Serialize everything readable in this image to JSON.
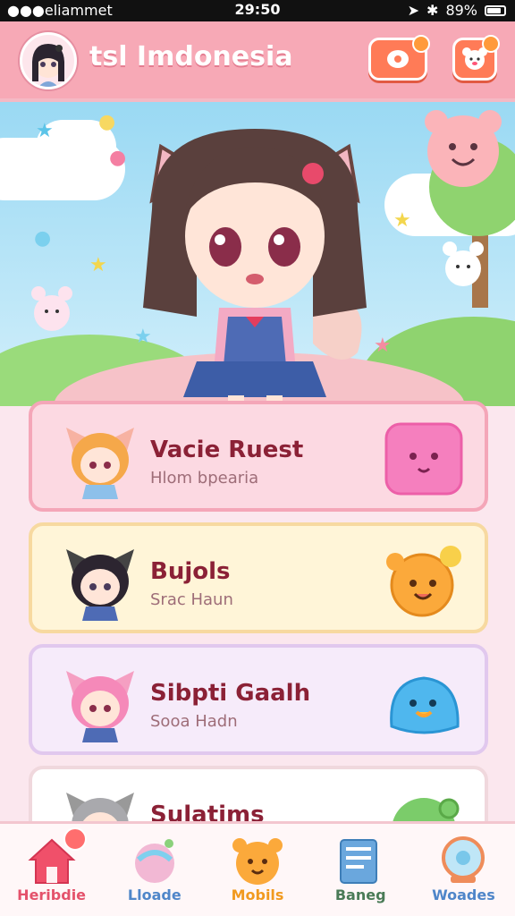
{
  "status_bar": {
    "carrier": "●●●eliammet",
    "time": "29:50",
    "battery": "89%"
  },
  "header": {
    "title": "tsl Imdonesia"
  },
  "cards": [
    {
      "name": "Vacie Ruest",
      "sub": "Hlom bpearia"
    },
    {
      "name": "Bujols",
      "sub": "Srac Haun"
    },
    {
      "name": "Sibpti Gaalh",
      "sub": "Sooa Hadn"
    },
    {
      "name": "Sulatims",
      "sub": ""
    }
  ],
  "nav": [
    {
      "label": "Heribdie",
      "color": "#e4526b",
      "icon": "home-icon"
    },
    {
      "label": "Lloade",
      "color": "#4f86c9",
      "icon": "bubble-icon"
    },
    {
      "label": "Mobils",
      "color": "#f19a1f",
      "icon": "bear-icon"
    },
    {
      "label": "Baneg",
      "color": "#4a7b57",
      "icon": "book-icon"
    },
    {
      "label": "Woades",
      "color": "#4f86c9",
      "icon": "globe-icon"
    }
  ]
}
